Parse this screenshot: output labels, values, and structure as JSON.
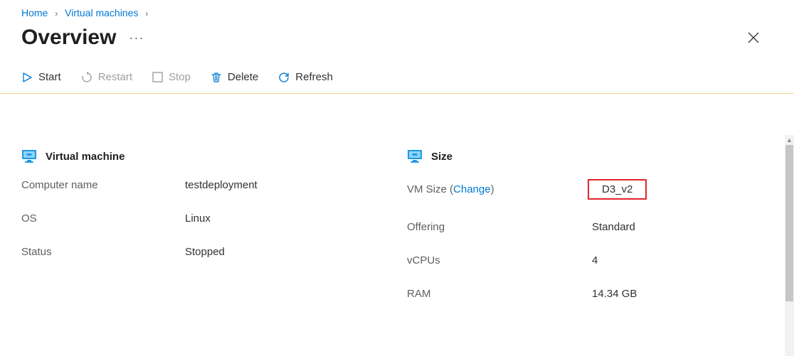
{
  "breadcrumb": {
    "home": "Home",
    "vms": "Virtual machines"
  },
  "header": {
    "title": "Overview",
    "more": "···"
  },
  "toolbar": {
    "start": "Start",
    "restart": "Restart",
    "stop": "Stop",
    "delete": "Delete",
    "refresh": "Refresh"
  },
  "sections": {
    "vm_title": "Virtual machine",
    "size_title": "Size"
  },
  "vm": {
    "computer_name_label": "Computer name",
    "computer_name_value": "testdeployment",
    "os_label": "OS",
    "os_value": "Linux",
    "status_label": "Status",
    "status_value": "Stopped"
  },
  "size": {
    "vm_size_label_prefix": "VM Size (",
    "vm_size_change": "Change",
    "vm_size_label_suffix": ")",
    "vm_size_value": "D3_v2",
    "offering_label": "Offering",
    "offering_value": "Standard",
    "vcpus_label": "vCPUs",
    "vcpus_value": "4",
    "ram_label": "RAM",
    "ram_value": "14.34 GB"
  }
}
